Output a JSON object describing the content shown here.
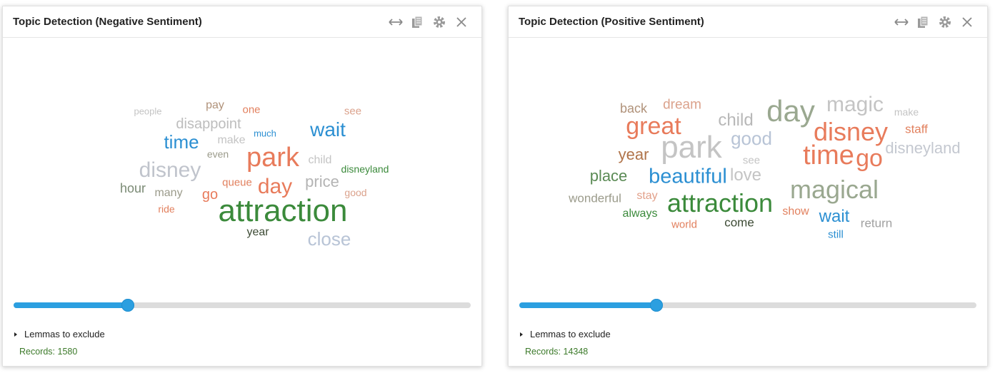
{
  "panels": [
    {
      "title": "Topic Detection (Negative Sentiment)",
      "icons": [
        "resize-horizontal-icon",
        "copy-icon",
        "gear-icon",
        "close-icon"
      ],
      "slider_value": 0.25,
      "lemmas_label": "Lemmas to exclude",
      "records_label": "Records: 1580",
      "words": [
        {
          "text": "people",
          "color": "#c4c4c4"
        },
        {
          "text": "pay",
          "color": "#b0927a"
        },
        {
          "text": "one",
          "color": "#e2815f"
        },
        {
          "text": "see",
          "color": "#dba28c"
        },
        {
          "text": "disappoint",
          "color": "#bdbdbd"
        },
        {
          "text": "much",
          "color": "#2b8fd2"
        },
        {
          "text": "wait",
          "color": "#2b8fd2"
        },
        {
          "text": "time",
          "color": "#2b8fd2"
        },
        {
          "text": "make",
          "color": "#c4c4c4"
        },
        {
          "text": "even",
          "color": "#9b9b8b"
        },
        {
          "text": "park",
          "color": "#e87b5b"
        },
        {
          "text": "child",
          "color": "#c4c4c4"
        },
        {
          "text": "disney",
          "color": "#c0c4cc"
        },
        {
          "text": "disneyland",
          "color": "#3b8a3b"
        },
        {
          "text": "queue",
          "color": "#e2815f"
        },
        {
          "text": "day",
          "color": "#e87b5b"
        },
        {
          "text": "price",
          "color": "#b4b4b4"
        },
        {
          "text": "hour",
          "color": "#7a8a74"
        },
        {
          "text": "many",
          "color": "#9b9b8b"
        },
        {
          "text": "go",
          "color": "#e87b5b"
        },
        {
          "text": "good",
          "color": "#dba28c"
        },
        {
          "text": "ride",
          "color": "#e2815f"
        },
        {
          "text": "attraction",
          "color": "#3b8a3b"
        },
        {
          "text": "year",
          "color": "#3c4a34"
        },
        {
          "text": "close",
          "color": "#b8c4d6"
        }
      ]
    },
    {
      "title": "Topic Detection (Positive Sentiment)",
      "icons": [
        "resize-horizontal-icon",
        "copy-icon",
        "gear-icon",
        "close-icon"
      ],
      "slider_value": 0.3,
      "lemmas_label": "Lemmas to exclude",
      "records_label": "Records: 14348",
      "words": [
        {
          "text": "back",
          "color": "#b0927a"
        },
        {
          "text": "dream",
          "color": "#dba28c"
        },
        {
          "text": "child",
          "color": "#b8b8b8"
        },
        {
          "text": "day",
          "color": "#9aa890"
        },
        {
          "text": "magic",
          "color": "#c4c4c4"
        },
        {
          "text": "make",
          "color": "#c4c4c4"
        },
        {
          "text": "great",
          "color": "#e87b5b"
        },
        {
          "text": "disney",
          "color": "#e87b5b"
        },
        {
          "text": "staff",
          "color": "#e2815f"
        },
        {
          "text": "good",
          "color": "#b8c4d6"
        },
        {
          "text": "park",
          "color": "#c4c4c4"
        },
        {
          "text": "year",
          "color": "#b0744a"
        },
        {
          "text": "see",
          "color": "#c4c4c4"
        },
        {
          "text": "time",
          "color": "#e87b5b"
        },
        {
          "text": "go",
          "color": "#e87b5b"
        },
        {
          "text": "disneyland",
          "color": "#c4c8d0"
        },
        {
          "text": "place",
          "color": "#5a8a54"
        },
        {
          "text": "beautiful",
          "color": "#2b8fd2"
        },
        {
          "text": "love",
          "color": "#c4c4c4"
        },
        {
          "text": "magical",
          "color": "#9aa890"
        },
        {
          "text": "wonderful",
          "color": "#9b9b8b"
        },
        {
          "text": "stay",
          "color": "#e2a08a"
        },
        {
          "text": "attraction",
          "color": "#3b8a3b"
        },
        {
          "text": "show",
          "color": "#e2815f"
        },
        {
          "text": "wait",
          "color": "#2b8fd2"
        },
        {
          "text": "always",
          "color": "#3b8a3b"
        },
        {
          "text": "world",
          "color": "#e2815f"
        },
        {
          "text": "come",
          "color": "#3c4a34"
        },
        {
          "text": "still",
          "color": "#2b8fd2"
        },
        {
          "text": "return",
          "color": "#a0a0a0"
        }
      ]
    }
  ]
}
